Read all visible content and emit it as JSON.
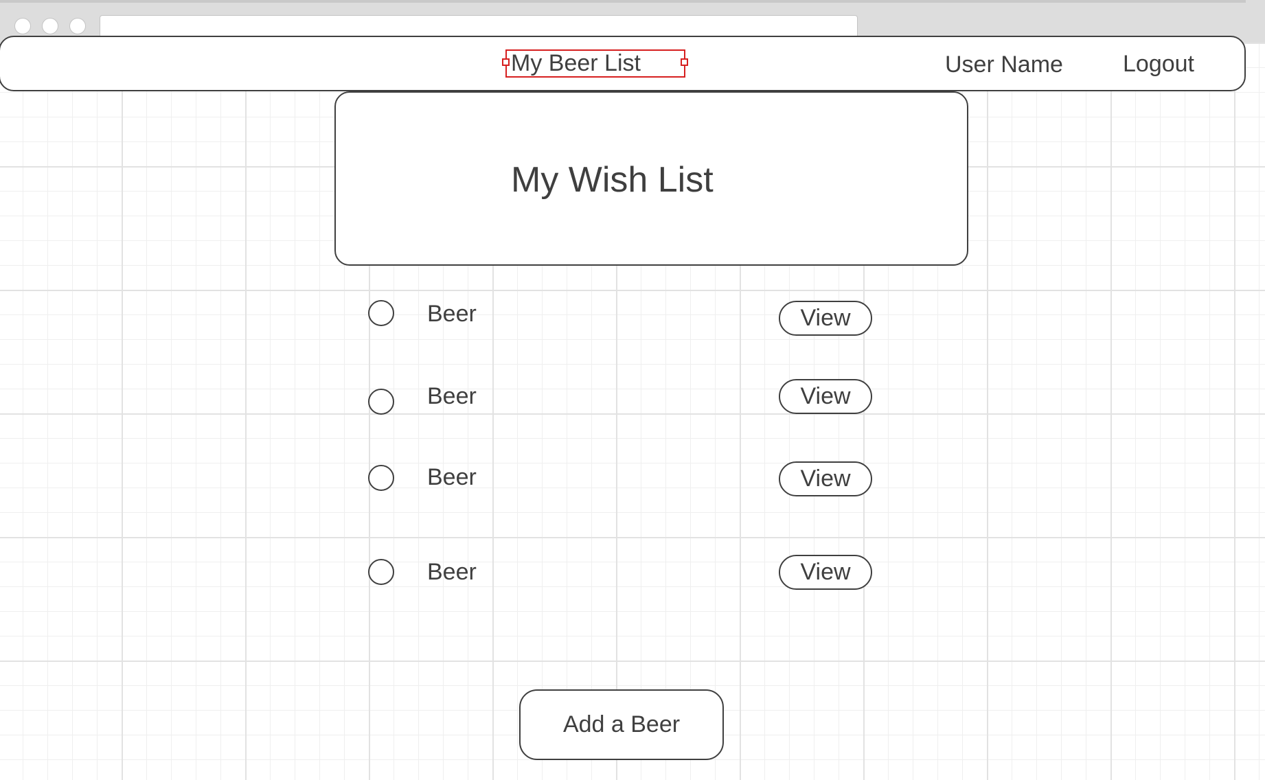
{
  "header": {
    "brand": "My Beer List",
    "user_name": "User Name",
    "logout": "Logout"
  },
  "main": {
    "title": "My Wish List",
    "items": [
      {
        "label": "Beer",
        "action": "View",
        "selected": false
      },
      {
        "label": "Beer",
        "action": "View",
        "selected": false
      },
      {
        "label": "Beer",
        "action": "View",
        "selected": false
      },
      {
        "label": "Beer",
        "action": "View",
        "selected": false
      }
    ],
    "add_button": "Add a Beer"
  },
  "colors": {
    "text": "#3f3f3f",
    "selection_outline": "#d61f1f",
    "grid_line": "#e2e2e2",
    "chrome": "#dddddd"
  }
}
